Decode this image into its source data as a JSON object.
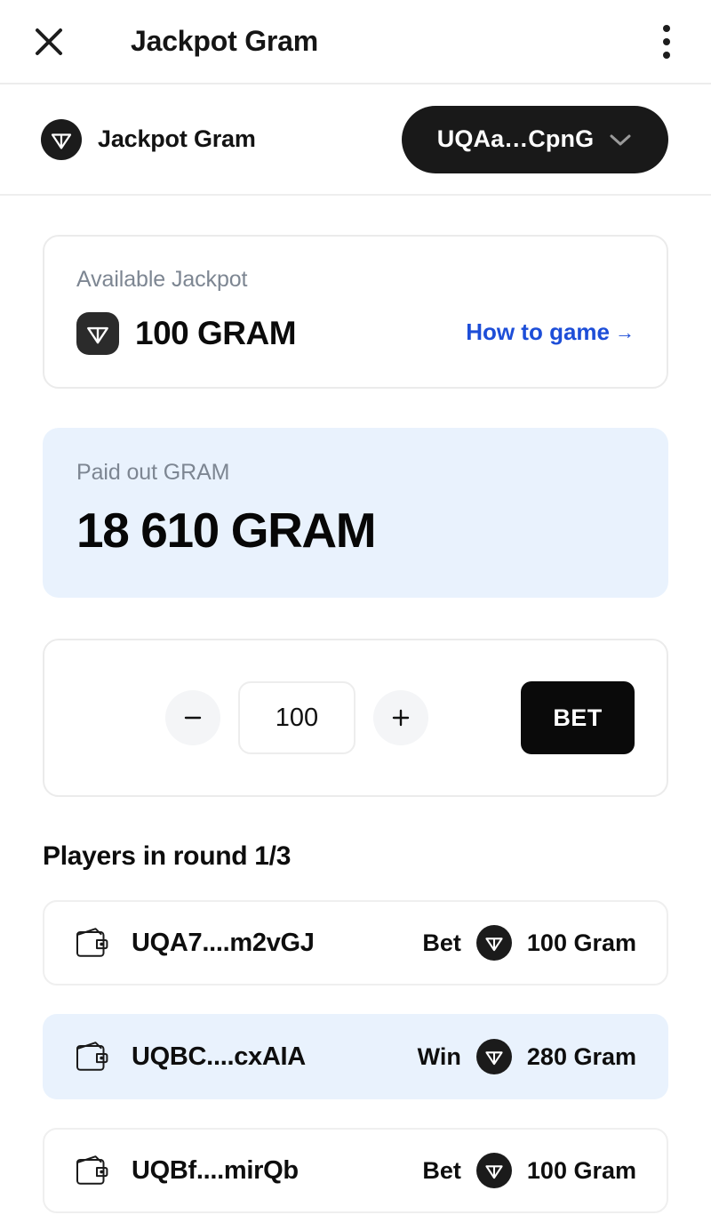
{
  "appbar": {
    "close_icon": "close-icon",
    "title": "Jackpot Gram",
    "menu_icon": "kebab-menu-icon"
  },
  "walletbar": {
    "brand_icon": "ton-logo-icon",
    "brand_name": "Jackpot Gram",
    "address": "UQAa…CpnG",
    "chevron_icon": "chevron-down-icon"
  },
  "jackpot": {
    "label": "Available Jackpot",
    "coin_icon": "ton-logo-icon",
    "amount": "100 GRAM",
    "link_label": "How to game",
    "link_arrow": "→",
    "link_color": "#1d4ed8"
  },
  "paid_out": {
    "label": "Paid out GRAM",
    "amount": "18 610 GRAM",
    "bg_color": "#e9f2fd"
  },
  "bet": {
    "decrement_label": "−",
    "increment_label": "+",
    "value": "100",
    "placeholder": "100",
    "submit_label": "BET"
  },
  "players": {
    "title": "Players in round 1/3",
    "rows": [
      {
        "wallet_icon": "wallet-icon",
        "address": "UQA7....m2vGJ",
        "status": "Bet",
        "coin_icon": "ton-logo-icon",
        "amount": "100 Gram",
        "highlight": false
      },
      {
        "wallet_icon": "wallet-icon",
        "address": "UQBC....cxAIA",
        "status": "Win",
        "coin_icon": "ton-logo-icon",
        "amount": "280 Gram",
        "highlight": true
      },
      {
        "wallet_icon": "wallet-icon",
        "address": "UQBf....mirQb",
        "status": "Bet",
        "coin_icon": "ton-logo-icon",
        "amount": "100 Gram",
        "highlight": false
      }
    ]
  }
}
